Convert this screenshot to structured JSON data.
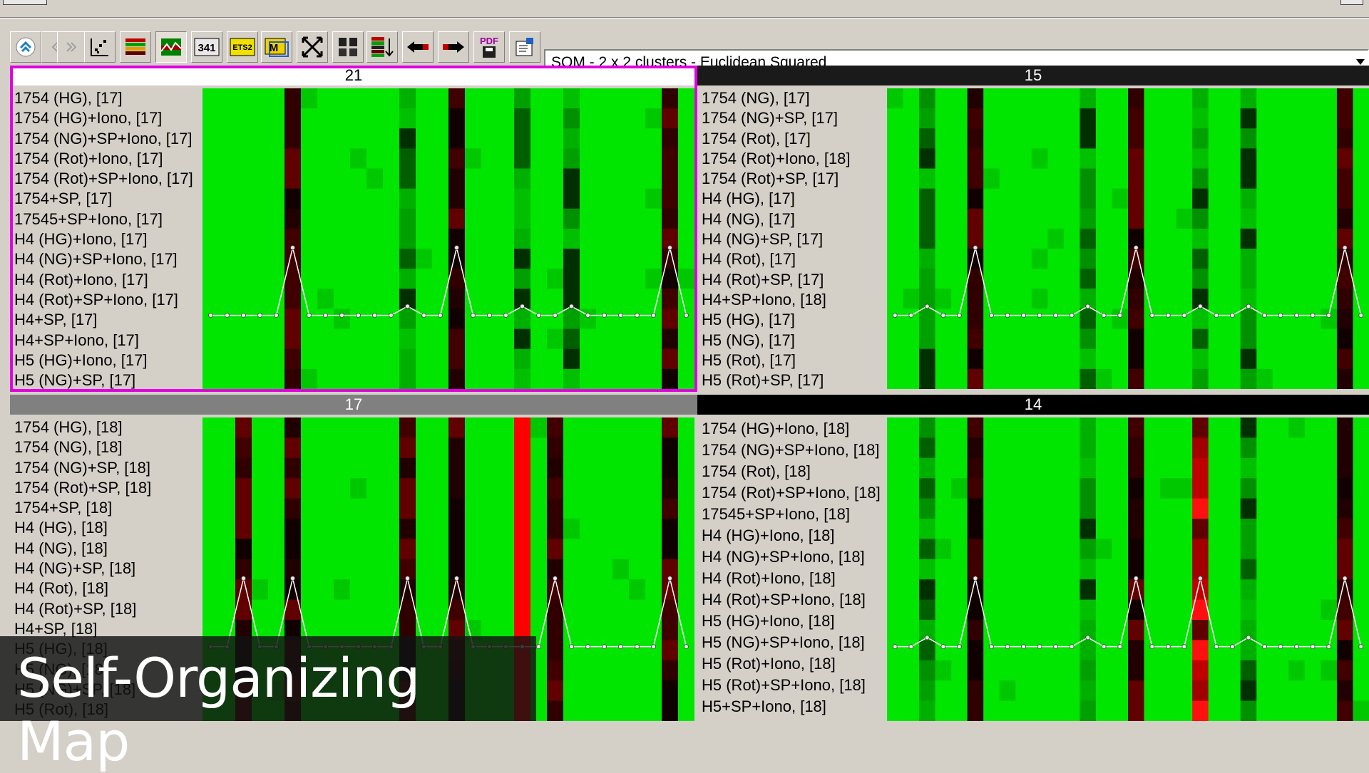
{
  "toolbar": {
    "buttons": [
      "home-icon",
      "first-page-icon",
      "prev-page-icon",
      "scatter-plot-icon",
      "heatmap-icon",
      "profile-chart-icon",
      "count-341-icon",
      "ets2-icon",
      "m-table-icon",
      "expand-icon",
      "columns-icon",
      "sort-rows-icon",
      "move-left-icon",
      "move-right-icon",
      "pdf-export-icon",
      "properties-icon"
    ],
    "count_label": "341",
    "ets_label": "ETS2",
    "m_label": "M",
    "pdf_label": "PDF",
    "combo_value": "SOM - 2 x 2 clusters - Euclidean Squared"
  },
  "colors": {
    "heat_green": "#00e600",
    "heat_red": "#ff0000",
    "selection": "#e000e0",
    "bg": "#d4d0c8"
  },
  "clusters": [
    {
      "id": "21",
      "labels": [
        "1754 (HG), [17]",
        "1754 (HG)+Iono, [17]",
        "1754 (NG)+SP+Iono, [17]",
        "1754 (Rot)+Iono, [17]",
        "1754 (Rot)+SP+Iono, [17]",
        "1754+SP, [17]",
        "17545+SP+Iono, [17]",
        "H4 (HG)+Iono, [17]",
        "H4 (NG)+SP+Iono, [17]",
        "H4 (Rot)+Iono, [17]",
        "H4 (Rot)+SP+Iono, [17]",
        "H4+SP, [17]",
        "H4+SP+Iono, [17]",
        "H5 (HG)+Iono, [17]",
        "H5 (NG)+SP, [17]"
      ]
    },
    {
      "id": "15",
      "labels": [
        "1754 (NG), [17]",
        "1754 (NG)+SP, [17]",
        "1754 (Rot), [17]",
        "1754 (Rot)+Iono, [18]",
        "1754 (Rot)+SP, [17]",
        "H4 (HG), [17]",
        "H4 (NG), [17]",
        "H4 (NG)+SP, [17]",
        "H4 (Rot), [17]",
        "H4 (Rot)+SP, [17]",
        "H4+SP+Iono, [18]",
        "H5 (HG), [17]",
        "H5 (NG), [17]",
        "H5 (Rot), [17]",
        "H5 (Rot)+SP, [17]"
      ]
    },
    {
      "id": "17",
      "labels": [
        "1754 (HG), [18]",
        "1754 (NG), [18]",
        "1754 (NG)+SP, [18]",
        "1754 (Rot)+SP, [18]",
        "1754+SP, [18]",
        "H4 (HG), [18]",
        "H4 (NG), [18]",
        "H4 (NG)+SP, [18]",
        "H4 (Rot), [18]",
        "H4 (Rot)+SP, [18]",
        "H4+SP, [18]",
        "H5 (HG), [18]",
        "H5 (NG), [18]",
        "H5 (NG)+SP, [18]",
        "H5 (Rot), [18]"
      ]
    },
    {
      "id": "14",
      "labels": [
        "1754 (HG)+Iono, [18]",
        "1754 (NG)+SP+Iono, [18]",
        "1754 (Rot), [18]",
        "1754 (Rot)+SP+Iono, [18]",
        "17545+SP+Iono, [18]",
        "H4 (HG)+Iono, [18]",
        "H4 (NG)+SP+Iono, [18]",
        "H4 (Rot)+Iono, [18]",
        "H4 (Rot)+SP+Iono, [18]",
        "H5 (HG)+Iono, [18]",
        "H5 (NG)+SP+Iono, [18]",
        "H5 (Rot)+Iono, [18]",
        "H5 (Rot)+SP+Iono, [18]",
        "H5+SP+Iono, [18]"
      ]
    }
  ],
  "caption": "Self-Organizing Map"
}
